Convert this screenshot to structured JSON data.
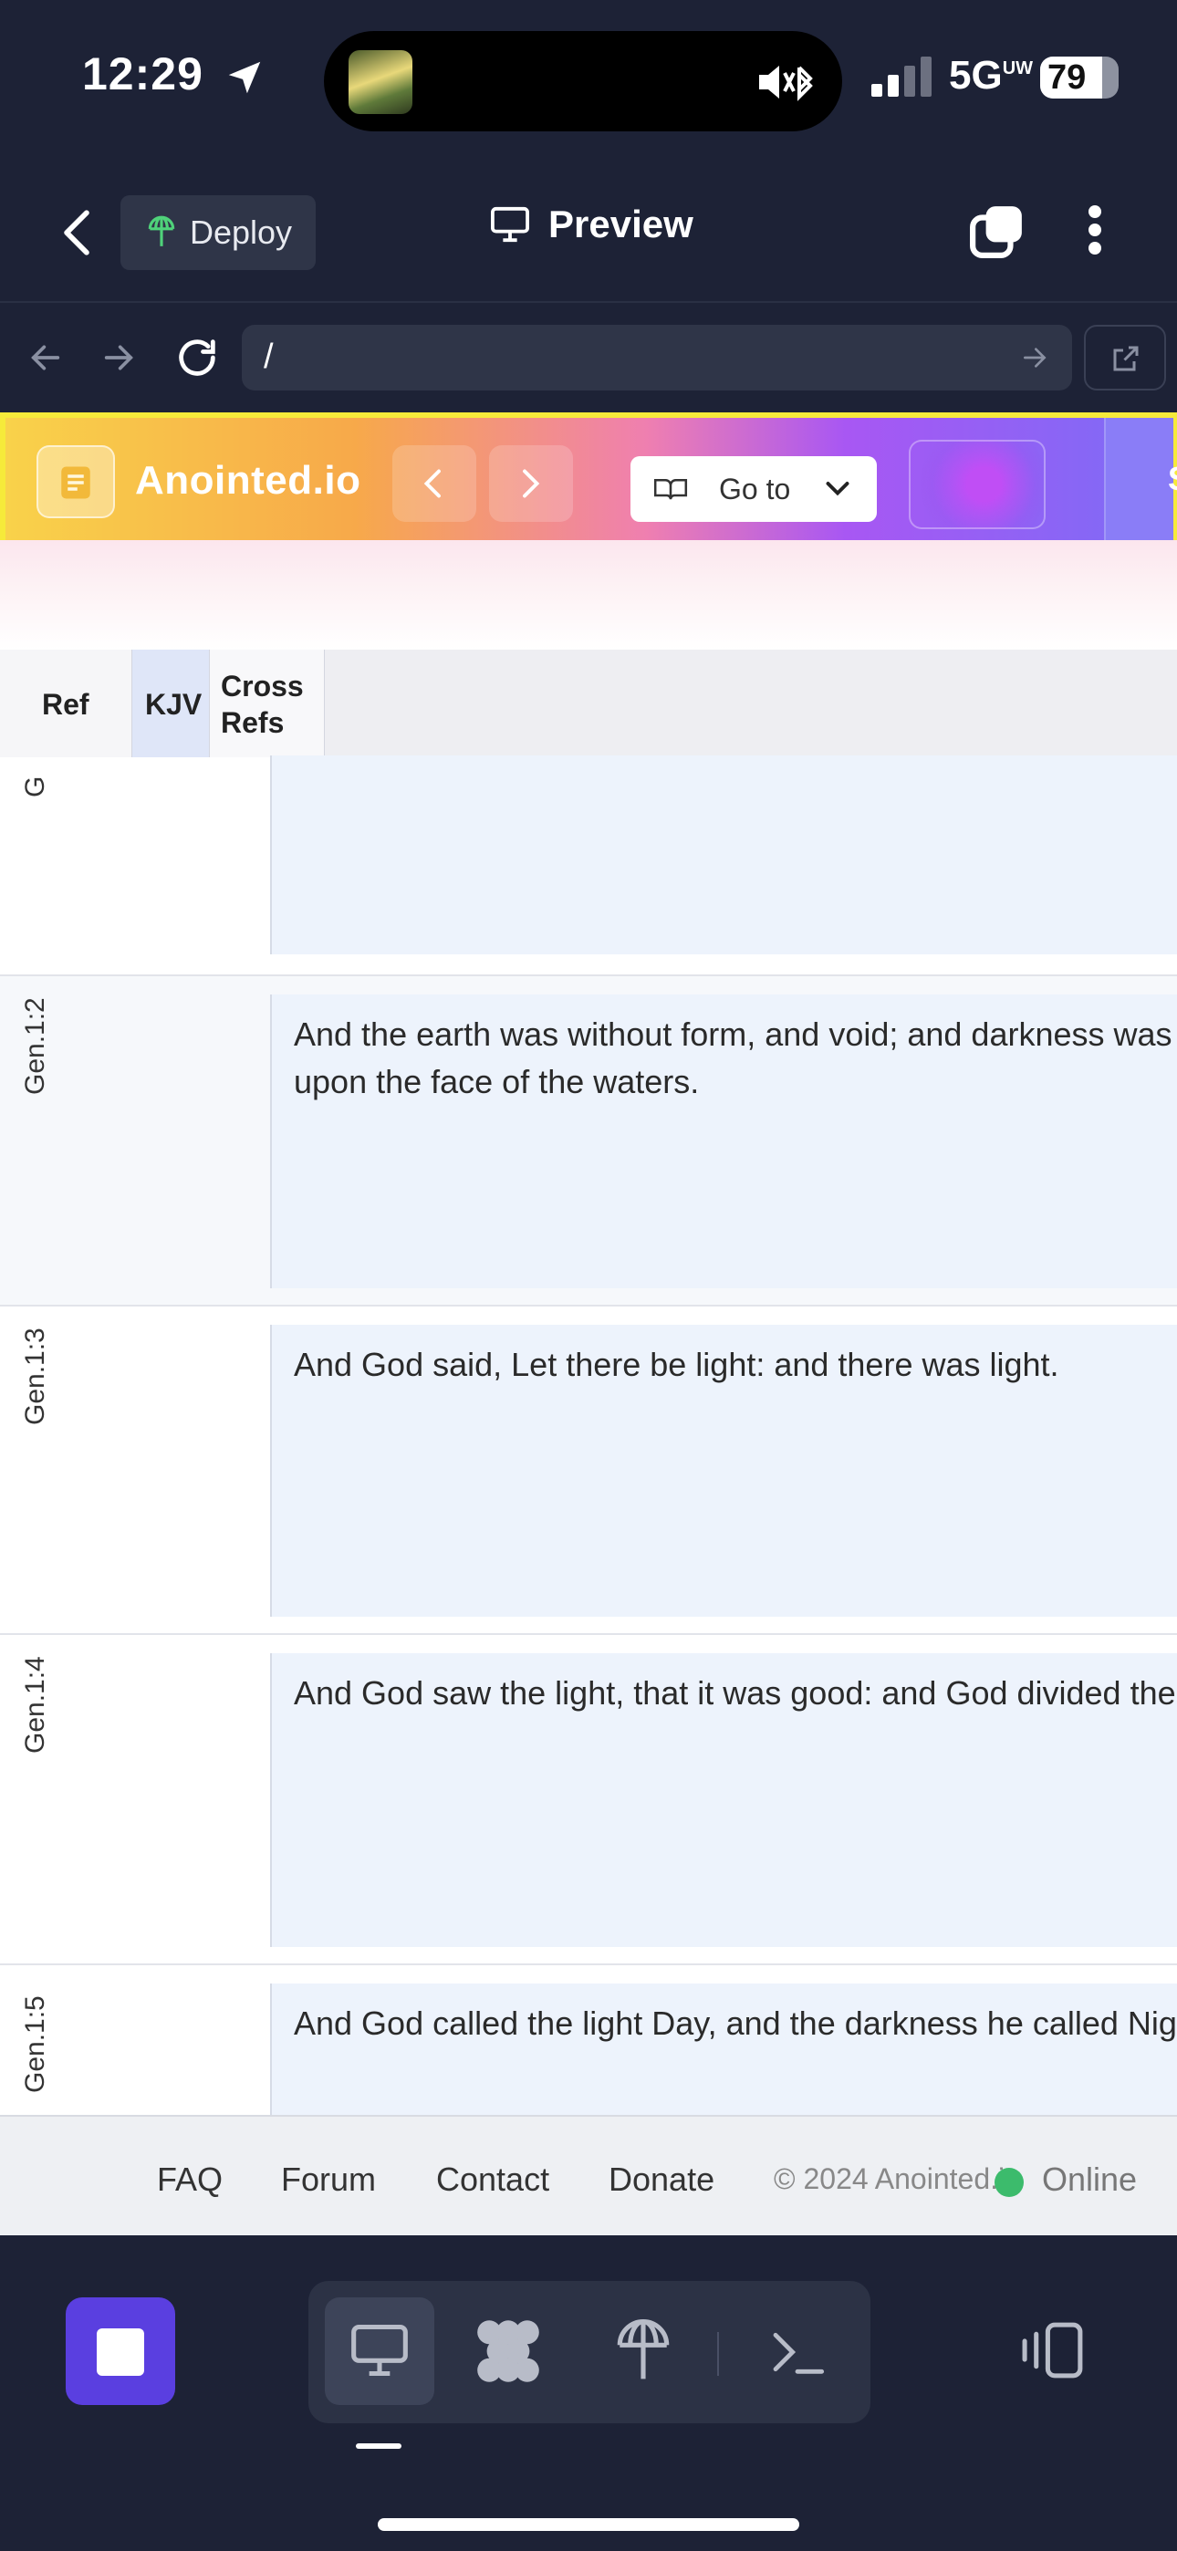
{
  "status": {
    "time": "12:29",
    "network": "5G",
    "network_sup": "UW",
    "battery": "79"
  },
  "app_header": {
    "deploy_label": "Deploy",
    "preview_label": "Preview"
  },
  "browser": {
    "url": "/"
  },
  "site": {
    "brand": "Anointed.io",
    "goto_label": "Go to",
    "edge_char": "S"
  },
  "table": {
    "headers": {
      "ref": "Ref",
      "kjv": "KJV",
      "cross_line1": "Cross",
      "cross_line2": "Refs"
    },
    "rows": [
      {
        "ref": "G",
        "lines": []
      },
      {
        "ref": "Gen.1:2",
        "lines": [
          "And the earth was without form, and void; and darkness was",
          "upon the face of the waters."
        ]
      },
      {
        "ref": "Gen.1:3",
        "lines": [
          "And God said, Let there be light: and there was light."
        ]
      },
      {
        "ref": "Gen.1:4",
        "lines": [
          "And God saw the light, that it was good: and God divided the"
        ]
      },
      {
        "ref": "Gen.1:5",
        "lines": [
          "And God called the light Day, and the darkness he called Nig"
        ]
      }
    ]
  },
  "footer": {
    "links": [
      "FAQ",
      "Forum",
      "Contact",
      "Donate"
    ],
    "copyright": "© 2024 Anointed.io",
    "status": "Online"
  },
  "colors": {
    "accent": "#5a3fe0",
    "online": "#3cbb6c",
    "dark_bg": "#1d2236"
  }
}
